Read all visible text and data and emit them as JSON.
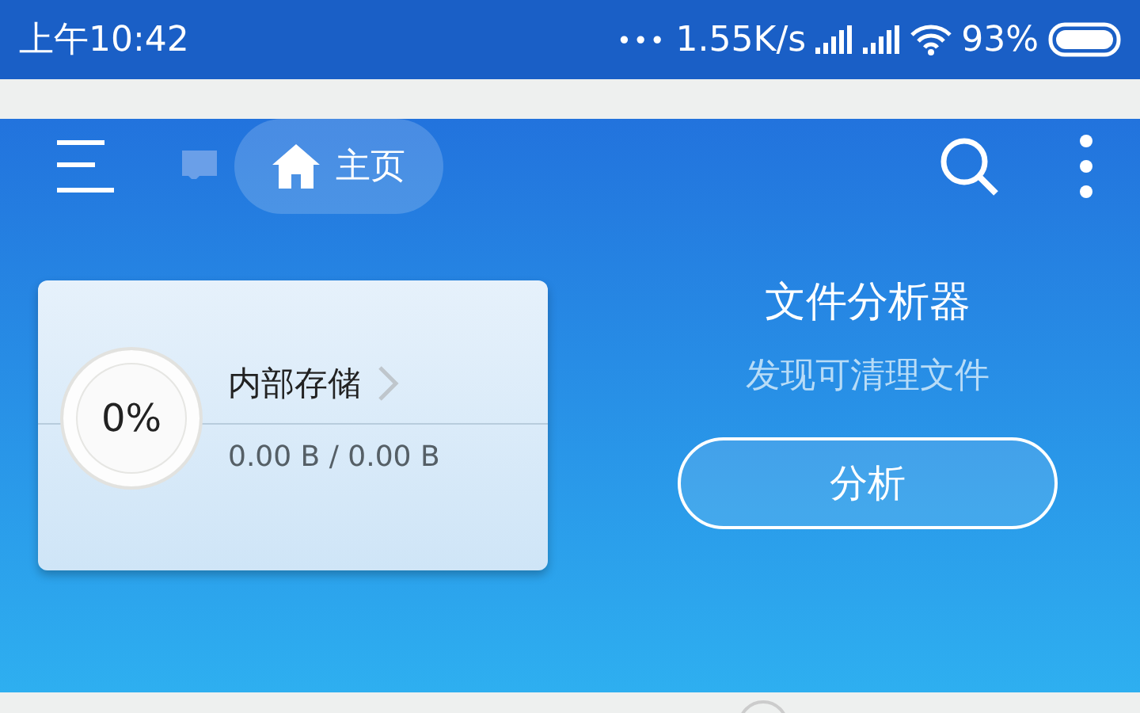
{
  "status_bar": {
    "time": "上午10:42",
    "dots": "•••",
    "speed": "1.55K/s",
    "battery": "93%"
  },
  "toolbar": {
    "breadcrumb": "主页"
  },
  "storage_card": {
    "percent": "0%",
    "title": "内部存储",
    "usage": "0.00 B / 0.00 B"
  },
  "analyzer": {
    "title": "文件分析器",
    "subtitle": "发现可清理文件",
    "button": "分析"
  }
}
